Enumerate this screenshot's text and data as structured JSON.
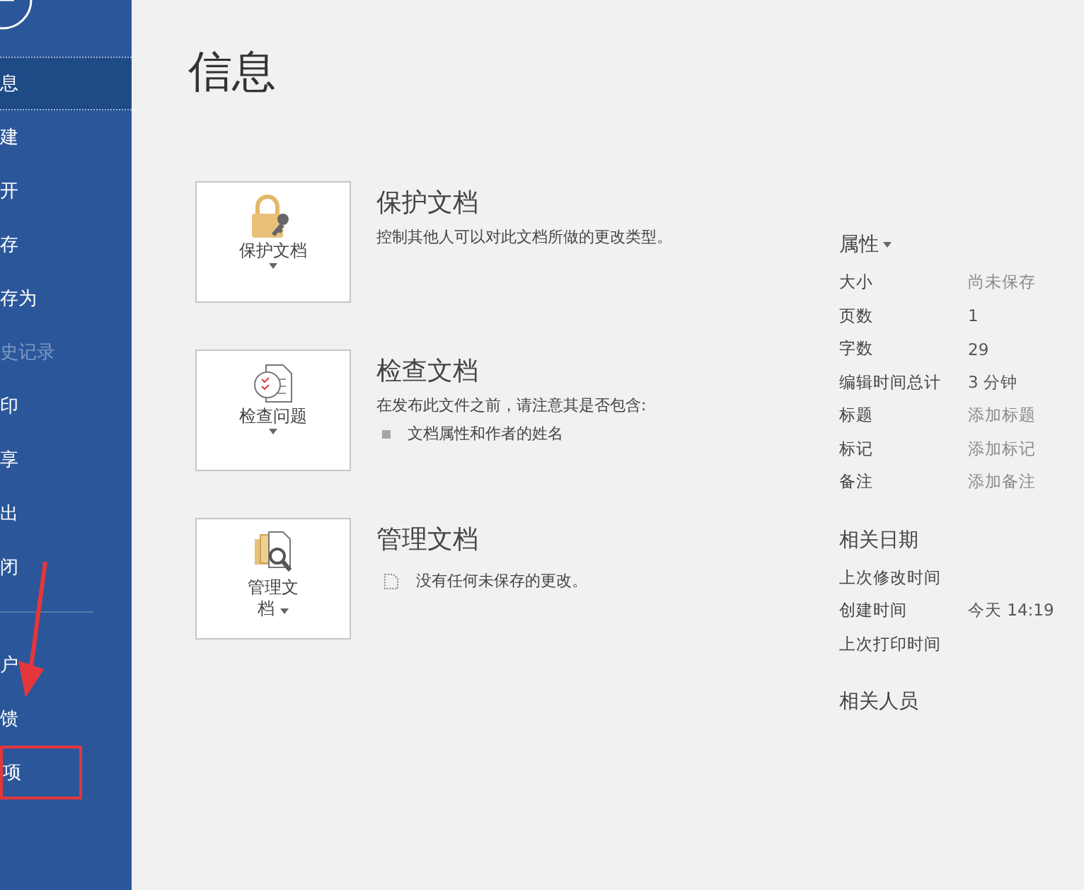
{
  "sidebar": {
    "items": [
      {
        "label": "息",
        "selected": true,
        "disabled": false,
        "highlighted": false
      },
      {
        "label": "建",
        "selected": false,
        "disabled": false,
        "highlighted": false
      },
      {
        "label": "开",
        "selected": false,
        "disabled": false,
        "highlighted": false
      },
      {
        "label": "存",
        "selected": false,
        "disabled": false,
        "highlighted": false
      },
      {
        "label": "存为",
        "selected": false,
        "disabled": false,
        "highlighted": false
      },
      {
        "label": "史记录",
        "selected": false,
        "disabled": true,
        "highlighted": false
      },
      {
        "label": "印",
        "selected": false,
        "disabled": false,
        "highlighted": false
      },
      {
        "label": "享",
        "selected": false,
        "disabled": false,
        "highlighted": false
      },
      {
        "label": "出",
        "selected": false,
        "disabled": false,
        "highlighted": false
      },
      {
        "label": "闭",
        "selected": false,
        "disabled": false,
        "highlighted": false
      }
    ],
    "lower_items": [
      {
        "label": "户",
        "selected": false,
        "disabled": false,
        "highlighted": false
      },
      {
        "label": "馈",
        "selected": false,
        "disabled": false,
        "highlighted": false
      },
      {
        "label": "项",
        "selected": false,
        "disabled": false,
        "highlighted": true
      }
    ]
  },
  "page_title": "信息",
  "sections": [
    {
      "kind": "protect",
      "button": "保护文档",
      "title": "保护文档",
      "description": "控制其他人可以对此文档所做的更改类型。"
    },
    {
      "kind": "inspect",
      "button": "检查问题",
      "title": "检查文档",
      "description": "在发布此文件之前，请注意其是否包含:",
      "bullets": [
        "文档属性和作者的姓名"
      ]
    },
    {
      "kind": "manage",
      "button": "管理文档",
      "title": "管理文档",
      "note": "没有任何未保存的更改。"
    }
  ],
  "properties": {
    "title": "属性",
    "rows": [
      {
        "label": "大小",
        "value": "尚未保存",
        "muted": true
      },
      {
        "label": "页数",
        "value": "1",
        "muted": false
      },
      {
        "label": "字数",
        "value": "29",
        "muted": false
      },
      {
        "label": "编辑时间总计",
        "value": "3 分钟",
        "muted": false
      },
      {
        "label": "标题",
        "value": "添加标题",
        "muted": true
      },
      {
        "label": "标记",
        "value": "添加标记",
        "muted": true
      },
      {
        "label": "备注",
        "value": "添加备注",
        "muted": true
      }
    ]
  },
  "related_dates": {
    "title": "相关日期",
    "rows": [
      {
        "label": "上次修改时间"
      },
      {
        "label": "创建时间",
        "value": "今天 14:19"
      },
      {
        "label": "上次打印时间"
      }
    ]
  },
  "related_people": {
    "title": "相关人员"
  }
}
